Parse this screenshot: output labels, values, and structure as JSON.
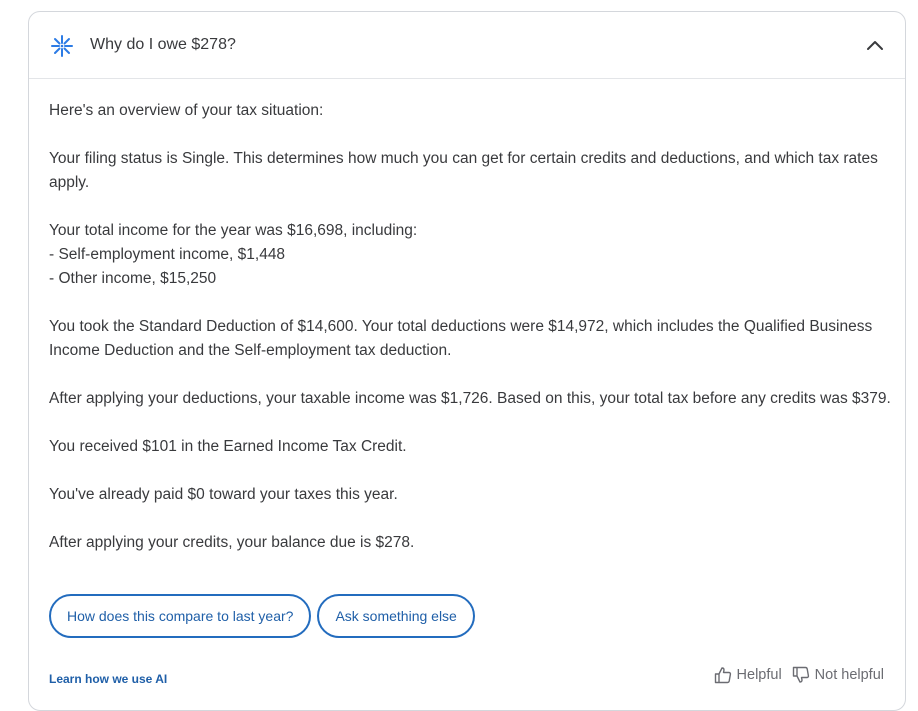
{
  "header": {
    "title": "Why do I owe $278?",
    "icon": "ai-sparkle-icon",
    "collapse_icon": "chevron-up-icon"
  },
  "body": {
    "paragraphs": [
      "Here's an overview of your tax situation:",
      "Your filing status is Single. This determines how much you can get for certain credits and deductions, and which tax rates apply.",
      "Your total income for the year was $16,698, including:\n- Self-employment income, $1,448\n- Other income, $15,250",
      "You took the Standard Deduction of $14,600. Your total deductions were $14,972, which includes the Qualified Business Income Deduction and the Self-employment tax deduction.",
      "After applying your deductions, your taxable income was $1,726. Based on this, your total tax before any credits was $379.",
      "You received $101 in the Earned Income Tax Credit.",
      "You've already paid $0 toward your taxes this year.",
      "After applying your credits, your balance due is $278."
    ]
  },
  "suggestions": [
    "How does this compare to last year?",
    "Ask something else"
  ],
  "footer": {
    "learn_link": "Learn how we use AI",
    "helpful_label": "Helpful",
    "not_helpful_label": "Not helpful",
    "helpful_icon": "thumbs-up-icon",
    "not_helpful_icon": "thumbs-down-icon"
  },
  "colors": {
    "accent": "#236cbe",
    "icon_blue": "#2c7be5",
    "text": "#393a3d",
    "muted": "#6b6c72",
    "border": "#d4d7dc"
  }
}
